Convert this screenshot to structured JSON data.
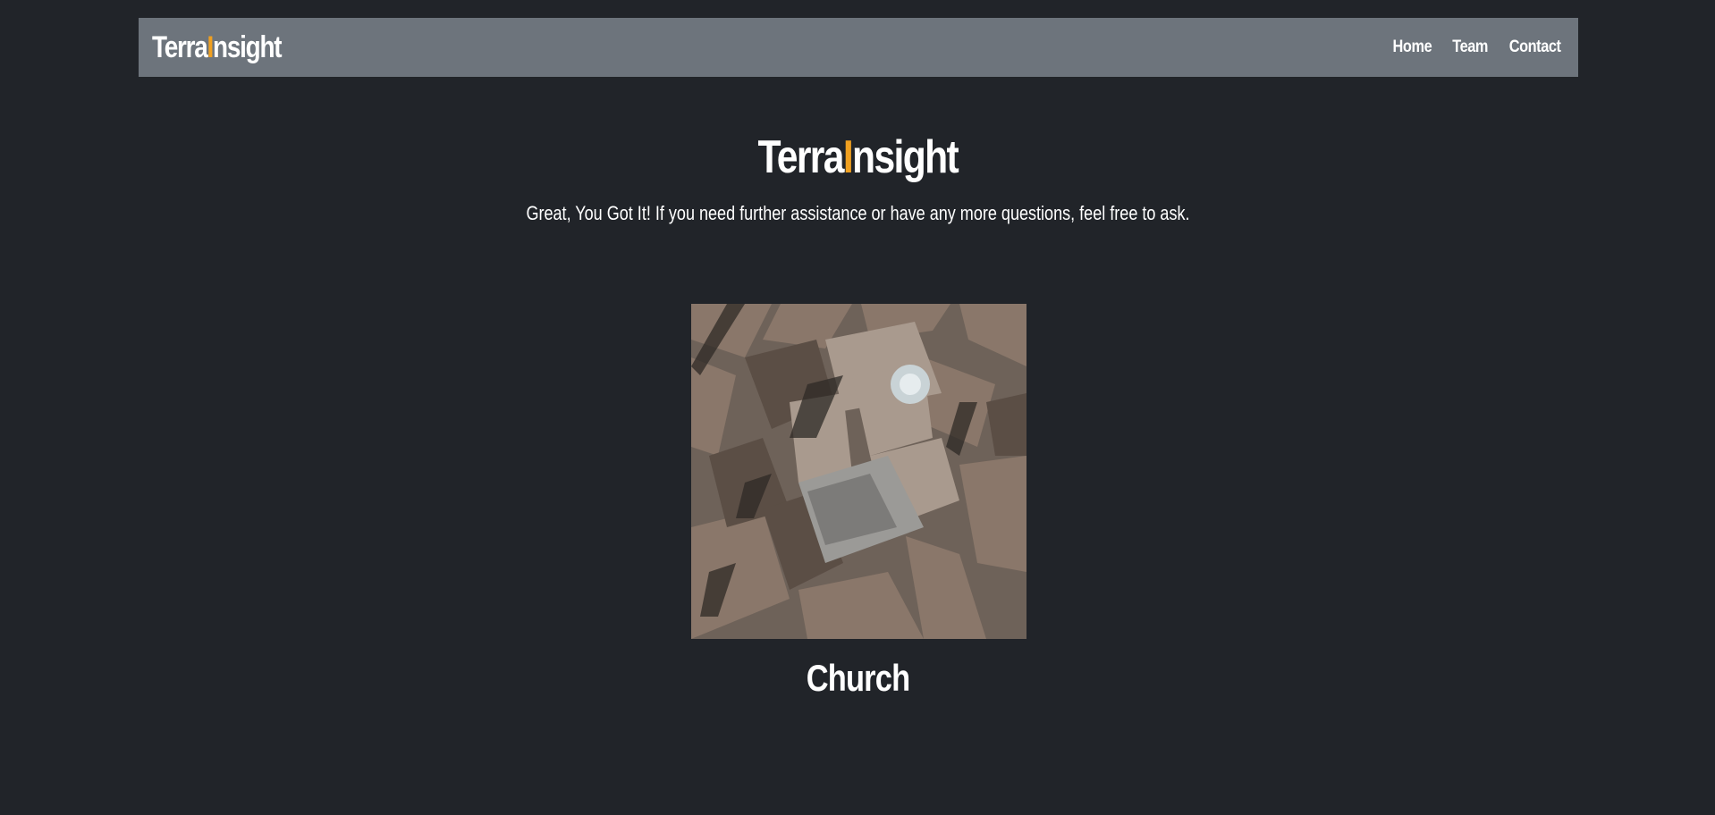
{
  "navbar": {
    "brand_part1": "Terra",
    "brand_accent": "I",
    "brand_part2": "nsight",
    "links": [
      "Home",
      "Team",
      "Contact"
    ]
  },
  "hero": {
    "title_part1": "Terra",
    "title_accent": "I",
    "title_part2": "nsight",
    "subtitle": "Great, You Got It! If you need further assistance or have any more questions, feel free to ask."
  },
  "result": {
    "image_description_icon": "aerial-photo-icon",
    "label": "Church"
  },
  "colors": {
    "background": "#212429",
    "navbar": "#6d747c",
    "accent": "#f0a020",
    "text": "#ffffff"
  }
}
